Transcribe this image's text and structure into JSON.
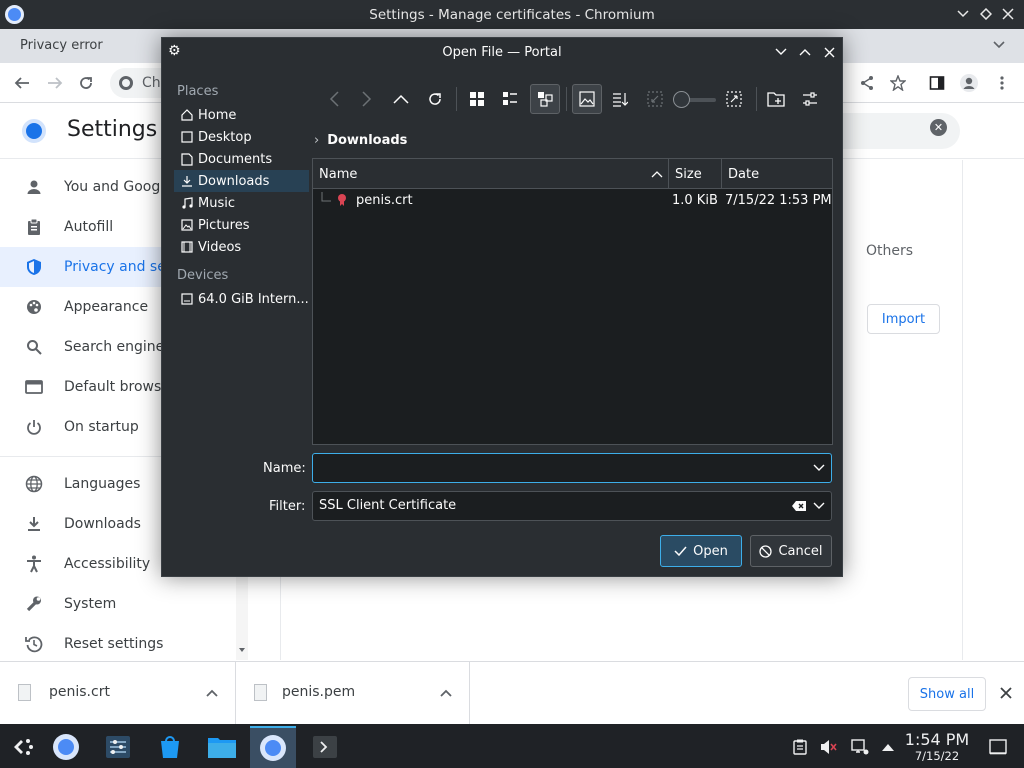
{
  "window": {
    "title": "Settings - Manage certificates - Chromium",
    "tab_title": "Privacy error",
    "omnibox_partial": "Ch"
  },
  "settings": {
    "title": "Settings",
    "sidebar": [
      {
        "label": "You and Google",
        "icon": "person-icon"
      },
      {
        "label": "Autofill",
        "icon": "clipboard-icon"
      },
      {
        "label": "Privacy and security",
        "icon": "shield-icon"
      },
      {
        "label": "Appearance",
        "icon": "palette-icon"
      },
      {
        "label": "Search engine",
        "icon": "search-icon"
      },
      {
        "label": "Default browser",
        "icon": "browser-icon"
      },
      {
        "label": "On startup",
        "icon": "power-icon"
      },
      {
        "label": "Languages",
        "icon": "globe-icon"
      },
      {
        "label": "Downloads",
        "icon": "download-icon"
      },
      {
        "label": "Accessibility",
        "icon": "accessibility-icon"
      },
      {
        "label": "System",
        "icon": "wrench-icon"
      },
      {
        "label": "Reset settings",
        "icon": "reset-icon"
      }
    ],
    "others_label": "Others",
    "import_label": "Import"
  },
  "dialog": {
    "title": "Open File — Portal",
    "places_header": "Places",
    "places": [
      {
        "label": "Home",
        "icon": "home-icon"
      },
      {
        "label": "Desktop",
        "icon": "desktop-icon"
      },
      {
        "label": "Documents",
        "icon": "documents-icon"
      },
      {
        "label": "Downloads",
        "icon": "downloads-icon"
      },
      {
        "label": "Music",
        "icon": "music-icon"
      },
      {
        "label": "Pictures",
        "icon": "pictures-icon"
      },
      {
        "label": "Videos",
        "icon": "videos-icon"
      }
    ],
    "devices_header": "Devices",
    "devices": [
      {
        "label": "64.0 GiB Intern...",
        "icon": "drive-icon"
      }
    ],
    "breadcrumb": "Downloads",
    "columns": {
      "name": "Name",
      "size": "Size",
      "date": "Date"
    },
    "files": [
      {
        "name": "penis.crt",
        "size": "1.0 KiB",
        "date": "7/15/22 1:53 PM"
      }
    ],
    "name_label": "Name:",
    "name_value": "",
    "filter_label": "Filter:",
    "filter_value": "SSL Client Certificate",
    "open_label": "Open",
    "cancel_label": "Cancel"
  },
  "downloads_shelf": {
    "items": [
      {
        "name": "penis.crt"
      },
      {
        "name": "penis.pem"
      }
    ],
    "show_all": "Show all"
  },
  "taskbar": {
    "time": "1:54 PM",
    "date": "7/15/22"
  },
  "colors": {
    "accent": "#3daee9",
    "chrome_blue": "#1a73e8",
    "dialog_bg": "#2a2e32",
    "list_bg": "#1b1e20"
  }
}
